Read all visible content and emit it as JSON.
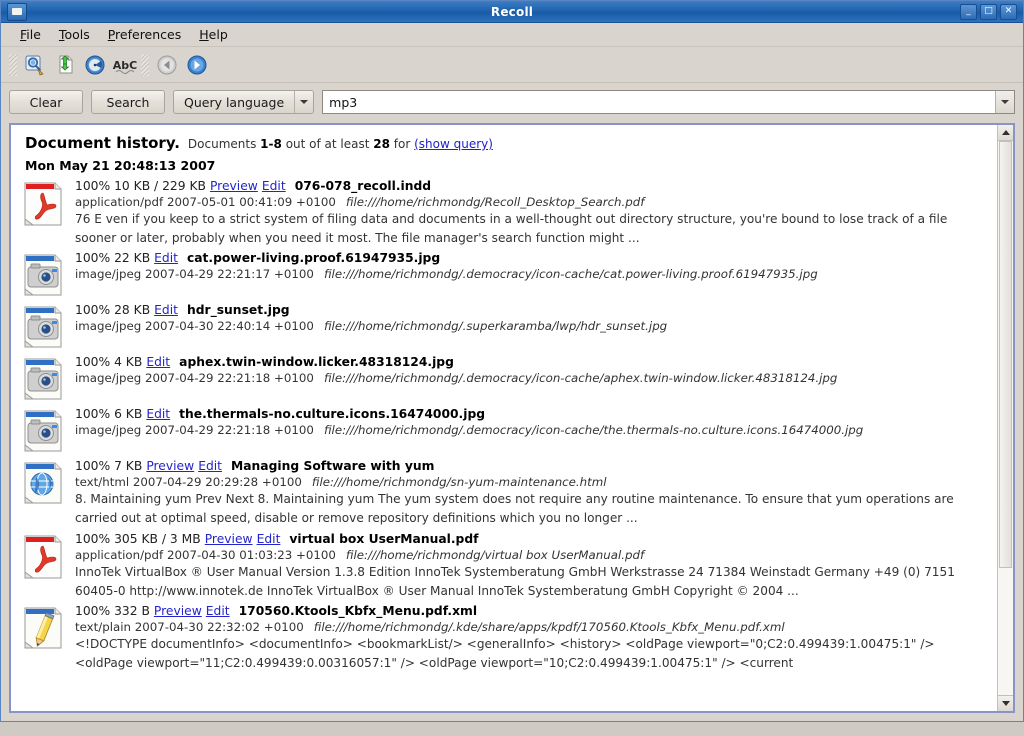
{
  "window": {
    "title": "Recoll",
    "icon": "app-window-icon",
    "buttons": {
      "minimize": "_",
      "maximize": "□",
      "close": "✕"
    }
  },
  "menubar": {
    "items": [
      {
        "label": "File",
        "mnemonic": "F"
      },
      {
        "label": "Tools",
        "mnemonic": "T"
      },
      {
        "label": "Preferences",
        "mnemonic": "P"
      },
      {
        "label": "Help",
        "mnemonic": "H"
      }
    ]
  },
  "toolbar": {
    "items": [
      {
        "name": "update-index-icon",
        "title": "Update index"
      },
      {
        "name": "index-document-icon",
        "title": "Index document"
      },
      {
        "name": "preferences-icon",
        "title": "Query configuration"
      },
      {
        "name": "spelling-abc-icon",
        "title": "Term explorer"
      },
      {
        "name": "back-arrow-icon",
        "title": "Back",
        "disabled": true
      },
      {
        "name": "forward-arrow-icon",
        "title": "Forward",
        "disabled": false
      }
    ]
  },
  "searchbar": {
    "clear_label": "Clear",
    "search_label": "Search",
    "mode_label": "Query language",
    "query_value": "mp3",
    "query_placeholder": ""
  },
  "results": {
    "header_title": "Document history.",
    "header_prefix": "Documents",
    "header_range": "1-8",
    "header_middle": "out of at least",
    "header_total": "28",
    "header_suffix": "for",
    "header_link": "(show query)",
    "date_group": "Mon May 21 20:48:13 2007",
    "entries": [
      {
        "icon": "pdf-file-icon",
        "percent": "100%",
        "size": "10 KB / 229 KB",
        "preview_label": "Preview",
        "edit_label": "Edit",
        "filename": "076-078_recoll.indd",
        "mime": "application/pdf",
        "date": "2007-05-01 00:41:09 +0100",
        "url": "file:///home/richmondg/Recoll_Desktop_Search.pdf",
        "snippet": "76 E ven if you keep to a strict system of filing data and documents in a well-thought out directory structure, you're bound to lose track of a file sooner or later, probably when you need it most. The file manager's search function might ..."
      },
      {
        "icon": "jpeg-file-icon",
        "percent": "100%",
        "size": "22 KB",
        "preview_label": "",
        "edit_label": "Edit",
        "filename": "cat.power-living.proof.61947935.jpg",
        "mime": "image/jpeg",
        "date": "2007-04-29 22:21:17 +0100",
        "url": "file:///home/richmondg/.democracy/icon-cache/cat.power-living.proof.61947935.jpg",
        "snippet": ""
      },
      {
        "icon": "jpeg-file-icon",
        "percent": "100%",
        "size": "28 KB",
        "preview_label": "",
        "edit_label": "Edit",
        "filename": "hdr_sunset.jpg",
        "mime": "image/jpeg",
        "date": "2007-04-30 22:40:14 +0100",
        "url": "file:///home/richmondg/.superkaramba/lwp/hdr_sunset.jpg",
        "snippet": ""
      },
      {
        "icon": "jpeg-file-icon",
        "percent": "100%",
        "size": "4 KB",
        "preview_label": "",
        "edit_label": "Edit",
        "filename": "aphex.twin-window.licker.48318124.jpg",
        "mime": "image/jpeg",
        "date": "2007-04-29 22:21:18 +0100",
        "url": "file:///home/richmondg/.democracy/icon-cache/aphex.twin-window.licker.48318124.jpg",
        "snippet": ""
      },
      {
        "icon": "jpeg-file-icon",
        "percent": "100%",
        "size": "6 KB",
        "preview_label": "",
        "edit_label": "Edit",
        "filename": "the.thermals-no.culture.icons.16474000.jpg",
        "mime": "image/jpeg",
        "date": "2007-04-29 22:21:18 +0100",
        "url": "file:///home/richmondg/.democracy/icon-cache/the.thermals-no.culture.icons.16474000.jpg",
        "snippet": ""
      },
      {
        "icon": "html-file-icon",
        "percent": "100%",
        "size": "7 KB",
        "preview_label": "Preview",
        "edit_label": "Edit",
        "filename": "Managing Software with yum",
        "mime": "text/html",
        "date": "2007-04-29 20:29:28 +0100",
        "url": "file:///home/richmondg/sn-yum-maintenance.html",
        "snippet": "   8. Maintaining yum Prev    Next 8. Maintaining yum The yum system does not require any routine maintenance. To ensure that yum operations are carried out at optimal speed, disable or remove repository definitions which you no longer ..."
      },
      {
        "icon": "pdf-file-icon",
        "percent": "100%",
        "size": "305 KB / 3 MB",
        "preview_label": "Preview",
        "edit_label": "Edit",
        "filename": "virtual box UserManual.pdf",
        "mime": "application/pdf",
        "date": "2007-04-30 01:03:23 +0100",
        "url": "file:///home/richmondg/virtual box UserManual.pdf",
        "snippet": "InnoTek VirtualBox ® User Manual Version 1.3.8 Edition InnoTek Systemberatung GmbH Werkstrasse 24 71384 Weinstadt Germany +49 (0) 7151 60405-0 http://www.innotek.de InnoTek VirtualBox ® User Manual InnoTek Systemberatung GmbH Copyright © 2004 ..."
      },
      {
        "icon": "text-file-icon",
        "percent": "100%",
        "size": "332 B",
        "preview_label": "Preview",
        "edit_label": "Edit",
        "filename": "170560.Ktools_Kbfx_Menu.pdf.xml",
        "mime": "text/plain",
        "date": "2007-04-30 22:32:02 +0100",
        "url": "file:///home/richmondg/.kde/share/apps/kpdf/170560.Ktools_Kbfx_Menu.pdf.xml",
        "snippet": "<!DOCTYPE documentInfo> <documentInfo> <bookmarkList/> <generalInfo> <history> <oldPage viewport=\"0;C2:0.499439:1.00475:1\" /> <oldPage viewport=\"11;C2:0.499439:0.00316057:1\" /> <oldPage viewport=\"10;C2:0.499439:1.00475:1\" /> <current"
      }
    ]
  },
  "scrollbar": {
    "up_arrow": "scroll-up-arrow",
    "down_arrow": "scroll-down-arrow",
    "thumb_position_percent": 0
  },
  "colors": {
    "titlebar": "#1f62ae",
    "link": "#2424cc",
    "panel_border": "#8a93c8",
    "window_bg": "#d9d5ce"
  }
}
